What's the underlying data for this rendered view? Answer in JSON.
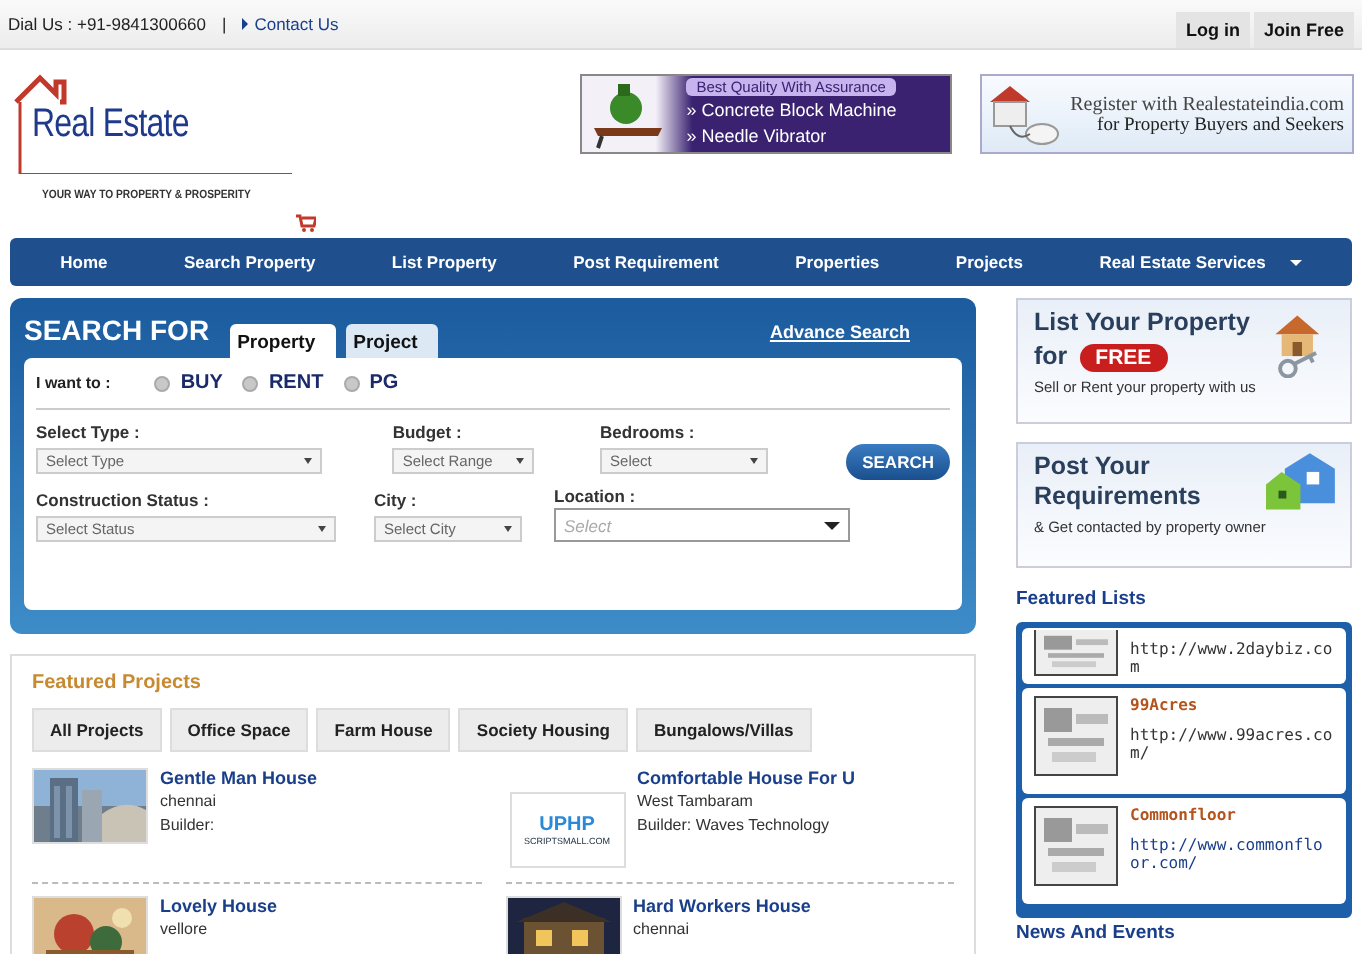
{
  "top_bar": {
    "dial": "Dial Us : +91-9841300660",
    "separator": "|",
    "contact_link": "Contact Us",
    "buttons": [
      "Log in",
      "Join Free"
    ]
  },
  "logo": {
    "name": "Real Estate",
    "tagline": "YOUR WAY TO PROPERTY & PROSPERITY"
  },
  "banners": [
    {
      "kind": "machine",
      "lines": [
        "Best Quality With Assurance",
        "» Concrete Block Machine",
        "» Needle Vibrator"
      ]
    },
    {
      "kind": "register",
      "lines": [
        "Register with Realestateindia.com",
        "for Property Buyers and Seekers"
      ]
    }
  ],
  "nav": [
    {
      "label": "Home",
      "dropdown": false
    },
    {
      "label": "Search Property",
      "dropdown": false
    },
    {
      "label": "List Property",
      "dropdown": false
    },
    {
      "label": "Post Requirement",
      "dropdown": false
    },
    {
      "label": "Properties",
      "dropdown": false
    },
    {
      "label": "Projects",
      "dropdown": false
    },
    {
      "label": "Real Estate Services",
      "dropdown": true
    }
  ],
  "search": {
    "title": "SEARCH FOR",
    "tabs": [
      {
        "label": "Property",
        "selected": true
      },
      {
        "label": "Project",
        "selected": false
      }
    ],
    "advance_link": "Advance Search",
    "want_label": "I want to :",
    "options": [
      {
        "label": "BUY",
        "selected": false
      },
      {
        "label": "RENT",
        "selected": false
      },
      {
        "label": "PG",
        "selected": false
      }
    ],
    "rows": [
      [
        {
          "label": "Select Type :",
          "placeholder": "Select Type"
        },
        {
          "label": "Budget :",
          "placeholder": "Select Range"
        },
        {
          "label": "Bedrooms :",
          "placeholder": "Select"
        }
      ],
      [
        {
          "label": "Construction Status :",
          "placeholder": "Select Status"
        },
        {
          "label": "City :",
          "placeholder": "Select City"
        },
        {
          "label": "Location :",
          "placeholder": "Select"
        }
      ]
    ],
    "button": "SEARCH"
  },
  "featured_projects": {
    "title": "Featured Projects",
    "tabs": [
      {
        "label": "All Projects",
        "selected": false
      },
      {
        "label": "Office Space",
        "selected": false
      },
      {
        "label": "Farm House",
        "selected": false
      },
      {
        "label": "Society Housing",
        "selected": false
      },
      {
        "label": "Bungalows/Villas",
        "selected": false
      }
    ],
    "items": [
      {
        "title": "Gentle Man House",
        "location": "chennai",
        "builder": "Builder:"
      },
      {
        "title": "Comfortable House For U",
        "location": "West Tambaram",
        "builder": "Builder: Waves Technology",
        "thumb_text": [
          "UPHP",
          "SCRIPTSMALL.COM"
        ]
      },
      {
        "title": "Lovely House",
        "location": "vellore"
      },
      {
        "title": "Hard Workers House",
        "location": "chennai"
      }
    ]
  },
  "promos": [
    {
      "kind": "list",
      "title": "List Your Property",
      "for": "for",
      "badge": "FREE",
      "subtitle": "Sell or Rent your property with us"
    },
    {
      "kind": "post",
      "title": "Post Your Requirements",
      "subtitle": "& Get contacted by property owner"
    }
  ],
  "featured_lists": {
    "title": "Featured Lists",
    "items": [
      {
        "url": "http://www.2daybiz.co m"
      },
      {
        "name": "99Acres",
        "url": "http://www.99acres.co m/"
      },
      {
        "name": "Commonfloor",
        "url": "http://www.commonflo or.com/"
      }
    ]
  },
  "news_title": "News And Events"
}
